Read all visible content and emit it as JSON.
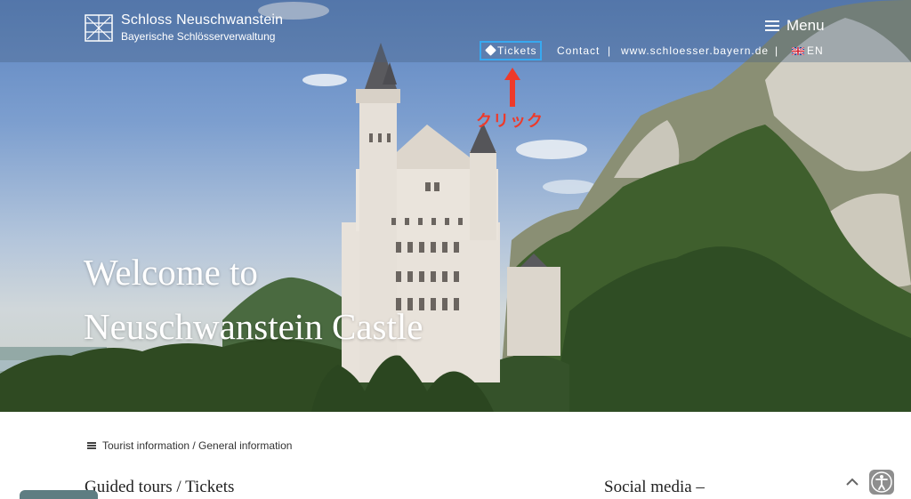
{
  "header": {
    "logo_title": "Schloss Neuschwanstein",
    "logo_subtitle": "Bayerische Schlösserverwaltung",
    "menu_label": "Menu"
  },
  "nav": {
    "tickets": "Tickets",
    "contact": "Contact",
    "separator": "|",
    "website": "www.schloesser.bayern.de",
    "language": "EN"
  },
  "annotation": {
    "label": "クリック",
    "color": "#ee3a2a",
    "highlight_color": "#38a9f0"
  },
  "hero": {
    "title_line1": "Welcome to",
    "title_line2": "Neuschwanstein Castle"
  },
  "breadcrumb": {
    "text": "Tourist information / General information"
  },
  "sections": {
    "left_heading": "Guided tours / Tickets",
    "right_heading": "Social media –"
  },
  "icons": {
    "ticket": "ticket-icon",
    "flag": "uk-flag-icon",
    "menu": "hamburger-icon",
    "scroll_top": "chevron-up-icon",
    "accessibility": "accessibility-icon"
  }
}
